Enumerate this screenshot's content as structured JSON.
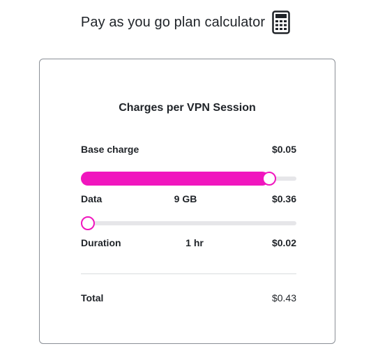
{
  "header": {
    "title": "Pay as you go plan calculator",
    "icon": "calculator-icon"
  },
  "card": {
    "heading": "Charges per VPN Session",
    "base_charge": {
      "label": "Base charge",
      "price": "$0.05"
    },
    "data": {
      "label": "Data",
      "value_label": "9 GB",
      "price": "$0.36",
      "slider_fraction": 0.87
    },
    "duration": {
      "label": "Duration",
      "value_label": "1 hr",
      "price": "$0.02",
      "slider_fraction": 0.0
    },
    "total": {
      "label": "Total",
      "price": "$0.43"
    }
  },
  "colors": {
    "accent": "#f016be",
    "track": "#e6e6e9",
    "border": "#8a8f96",
    "text": "#1f2328"
  }
}
